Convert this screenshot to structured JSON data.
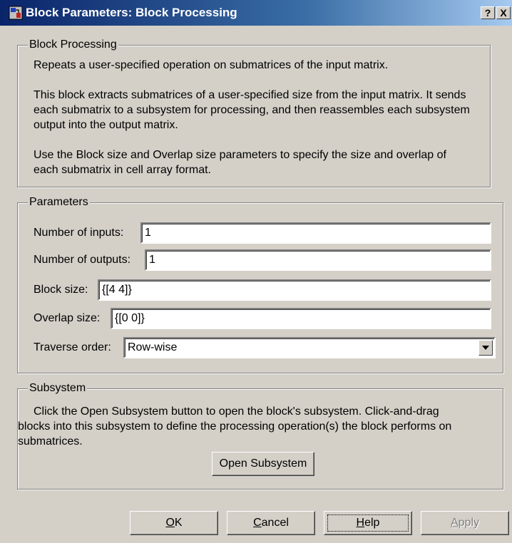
{
  "window": {
    "title": "Block Parameters: Block Processing",
    "help_button": "?",
    "close_button": "X"
  },
  "block_processing": {
    "legend": "Block Processing",
    "line1": "Repeats a user-specified operation on submatrices of the input matrix.",
    "line2": "This block extracts submatrices of a user-specified size from the input matrix. It sends",
    "line3": "each submatrix to a subsystem for processing, and then reassembles each subsystem",
    "line4": "output into the output matrix.",
    "line5": "Use the Block size and Overlap size parameters to specify the size and overlap of",
    "line6": "each submatrix in cell array format."
  },
  "parameters": {
    "legend": "Parameters",
    "num_inputs_label": "Number of inputs:",
    "num_inputs_value": "1",
    "num_outputs_label": "Number of outputs:",
    "num_outputs_value": "1",
    "block_size_label": "Block size:",
    "block_size_value": "{[4 4]}",
    "overlap_size_label": "Overlap size:",
    "overlap_size_value": "{[0 0]}",
    "traverse_order_label": "Traverse order:",
    "traverse_order_value": "Row-wise"
  },
  "subsystem": {
    "legend": "Subsystem",
    "line1": "Click the Open Subsystem button to open the block's subsystem. Click-and-drag",
    "line2": "blocks into this subsystem to define the processing operation(s) the block performs on",
    "line3": "submatrices.",
    "open_button": "Open Subsystem"
  },
  "buttons": {
    "ok_first": "O",
    "ok_rest": "K",
    "cancel_first": "C",
    "cancel_rest": "ancel",
    "help_first": "H",
    "help_rest": "elp",
    "apply_first": "A",
    "apply_rest": "pply"
  },
  "colors": {
    "face": "#d4d0c8",
    "title_start": "#0a246a",
    "title_end": "#a6caf0"
  },
  "icons": {
    "app": "simulink-block-icon",
    "dropdown": "chevron-down-icon"
  }
}
